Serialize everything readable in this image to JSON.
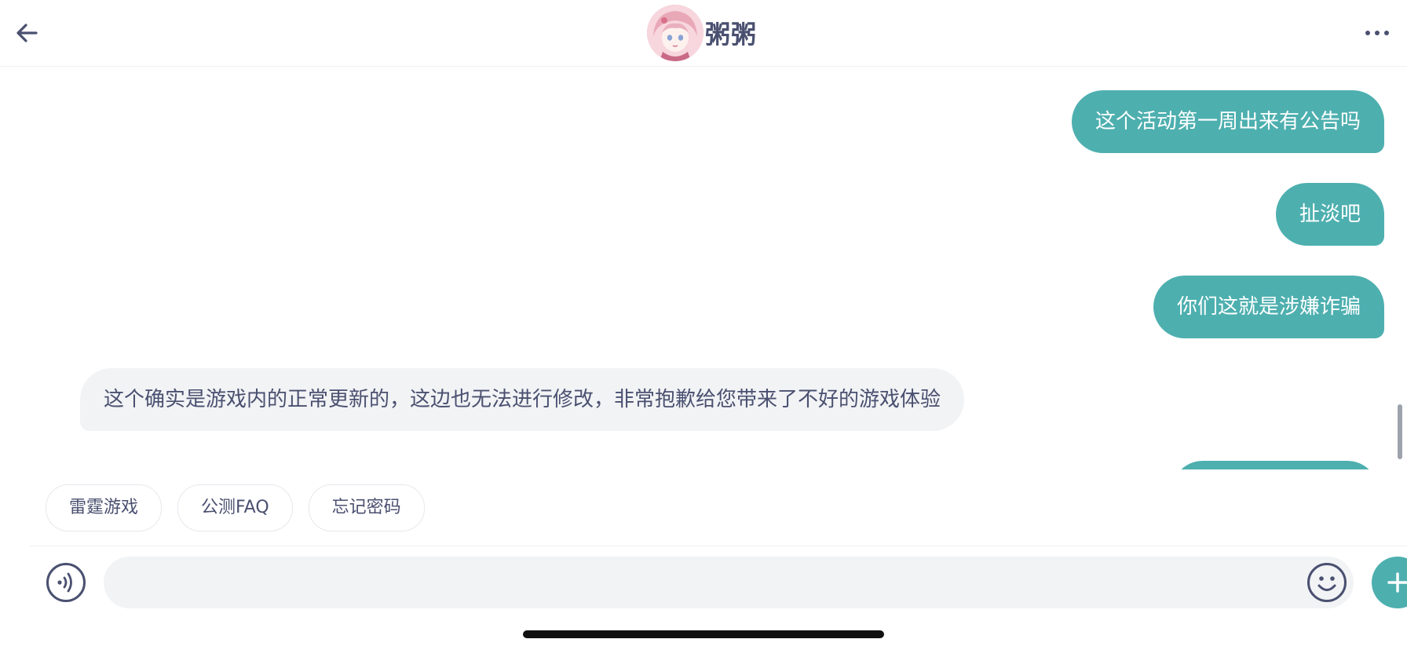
{
  "header": {
    "title": "粥粥",
    "back_icon": "arrow-left-icon",
    "more_icon": "more-horizontal-icon"
  },
  "messages": [
    {
      "side": "out",
      "text": "这个活动第一周出来有公告吗"
    },
    {
      "side": "out",
      "text": "扯淡吧"
    },
    {
      "side": "out",
      "text": "你们这就是涉嫌诈骗"
    },
    {
      "side": "in",
      "text": "这个确实是游戏内的正常更新的，这边也无法进行修改，非常抱歉给您带来了不好的游戏体验"
    }
  ],
  "quick_replies": [
    "雷霆游戏",
    "公测FAQ",
    "忘记密码"
  ],
  "input": {
    "value": "",
    "placeholder": "",
    "voice_icon": "voice-icon",
    "emoji_icon": "emoji-icon",
    "plus_icon": "plus-icon"
  },
  "colors": {
    "accent": "#4eafaf",
    "incoming_bubble": "#f2f3f5",
    "text": "#4a5070"
  }
}
